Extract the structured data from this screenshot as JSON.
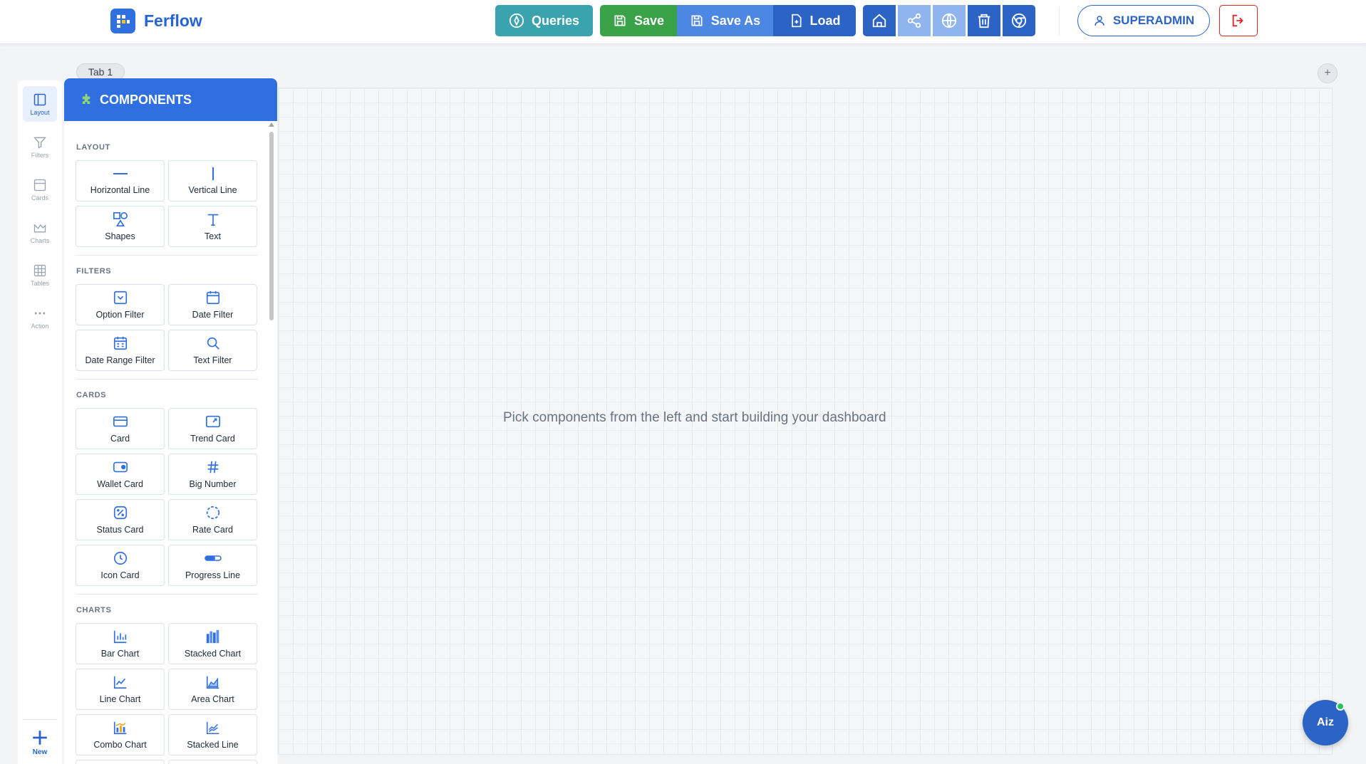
{
  "app": {
    "name": "Ferflow"
  },
  "toolbar": {
    "queries_label": "Queries",
    "save_label": "Save",
    "save_as_label": "Save As",
    "load_label": "Load",
    "user_label": "SUPERADMIN"
  },
  "rail": {
    "items": [
      {
        "label": "Layout",
        "icon": "layout-icon",
        "active": true
      },
      {
        "label": "Filters",
        "icon": "filter-icon"
      },
      {
        "label": "Cards",
        "icon": "card-icon"
      },
      {
        "label": "Charts",
        "icon": "chart-icon"
      },
      {
        "label": "Tables",
        "icon": "table-icon"
      },
      {
        "label": "Action",
        "icon": "more-icon"
      }
    ],
    "new_label": "New"
  },
  "tabs": [
    {
      "label": "Tab 1"
    }
  ],
  "panel": {
    "title": "COMPONENTS",
    "sections": [
      {
        "title": "LAYOUT",
        "items": [
          "Horizontal Line",
          "Vertical Line",
          "Shapes",
          "Text"
        ]
      },
      {
        "title": "FILTERS",
        "items": [
          "Option Filter",
          "Date Filter",
          "Date Range Filter",
          "Text Filter"
        ]
      },
      {
        "title": "CARDS",
        "items": [
          "Card",
          "Trend Card",
          "Wallet Card",
          "Big Number",
          "Status Card",
          "Rate Card",
          "Icon Card",
          "Progress Line"
        ]
      },
      {
        "title": "CHARTS",
        "items": [
          "Bar Chart",
          "Stacked Chart",
          "Line Chart",
          "Area Chart",
          "Combo Chart",
          "Stacked Line"
        ]
      }
    ]
  },
  "canvas": {
    "empty_message": "Pick components from the left and start building your dashboard"
  },
  "assistant": {
    "label": "Aiz"
  },
  "colors": {
    "primary": "#2f6fe0",
    "teal": "#3ba3ad",
    "green": "#3aa34a",
    "danger": "#dc2626"
  }
}
